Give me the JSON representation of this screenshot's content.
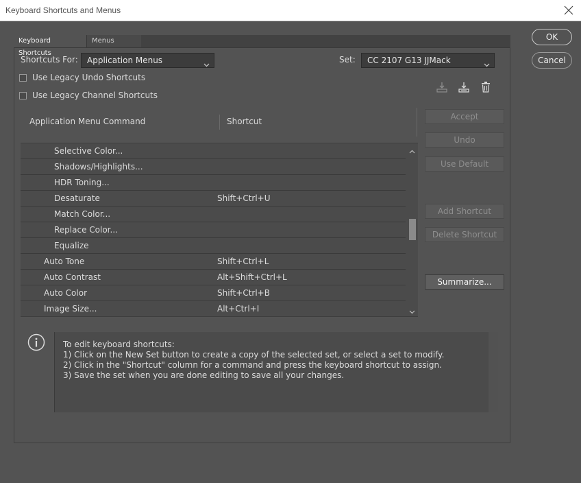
{
  "window": {
    "title": "Keyboard Shortcuts and Menus"
  },
  "tabs": [
    {
      "label": "Keyboard Shortcuts",
      "active": true
    },
    {
      "label": "Menus",
      "active": false
    }
  ],
  "shortcuts_for": {
    "label": "Shortcuts For:",
    "value": "Application Menus"
  },
  "set": {
    "label": "Set:",
    "value": "CC 2107 G13 JJMack"
  },
  "options": [
    {
      "label": "Use Legacy Undo Shortcuts",
      "checked": false
    },
    {
      "label": "Use Legacy Channel Shortcuts",
      "checked": false
    }
  ],
  "set_icons": [
    "save-set-icon",
    "new-set-icon",
    "delete-set-icon"
  ],
  "table": {
    "headers": [
      "Application Menu Command",
      "Shortcut"
    ],
    "rows": [
      {
        "command": "Selective Color...",
        "shortcut": "",
        "indent": 2
      },
      {
        "command": "Shadows/Highlights...",
        "shortcut": "",
        "indent": 2
      },
      {
        "command": "HDR Toning...",
        "shortcut": "",
        "indent": 2
      },
      {
        "command": "Desaturate",
        "shortcut": "Shift+Ctrl+U",
        "indent": 2
      },
      {
        "command": "Match Color...",
        "shortcut": "",
        "indent": 2
      },
      {
        "command": "Replace Color...",
        "shortcut": "",
        "indent": 2
      },
      {
        "command": "Equalize",
        "shortcut": "",
        "indent": 2
      },
      {
        "command": "Auto Tone",
        "shortcut": "Shift+Ctrl+L",
        "indent": 1
      },
      {
        "command": "Auto Contrast",
        "shortcut": "Alt+Shift+Ctrl+L",
        "indent": 1
      },
      {
        "command": "Auto Color",
        "shortcut": "Shift+Ctrl+B",
        "indent": 1
      },
      {
        "command": "Image Size...",
        "shortcut": "Alt+Ctrl+I",
        "indent": 1
      }
    ]
  },
  "side_buttons": [
    {
      "label": "Accept",
      "enabled": false
    },
    {
      "label": "Undo",
      "enabled": false
    },
    {
      "label": "Use Default",
      "enabled": false
    },
    {
      "label": "Add Shortcut",
      "enabled": false
    },
    {
      "label": "Delete Shortcut",
      "enabled": false
    },
    {
      "label": "Summarize...",
      "enabled": true
    }
  ],
  "dialog_buttons": {
    "ok": "OK",
    "cancel": "Cancel"
  },
  "info": {
    "lines": [
      "To edit keyboard shortcuts:",
      "1) Click on the New Set button to create a copy of the selected set, or select a set to modify.",
      "2) Click in the \"Shortcut\" column for a command and press the keyboard shortcut to assign.",
      "3) Save the set when you are done editing to save all your changes."
    ]
  },
  "colors": {
    "background": "#535353",
    "panel": "#4b4b4b",
    "text": "#dcdcdc"
  }
}
